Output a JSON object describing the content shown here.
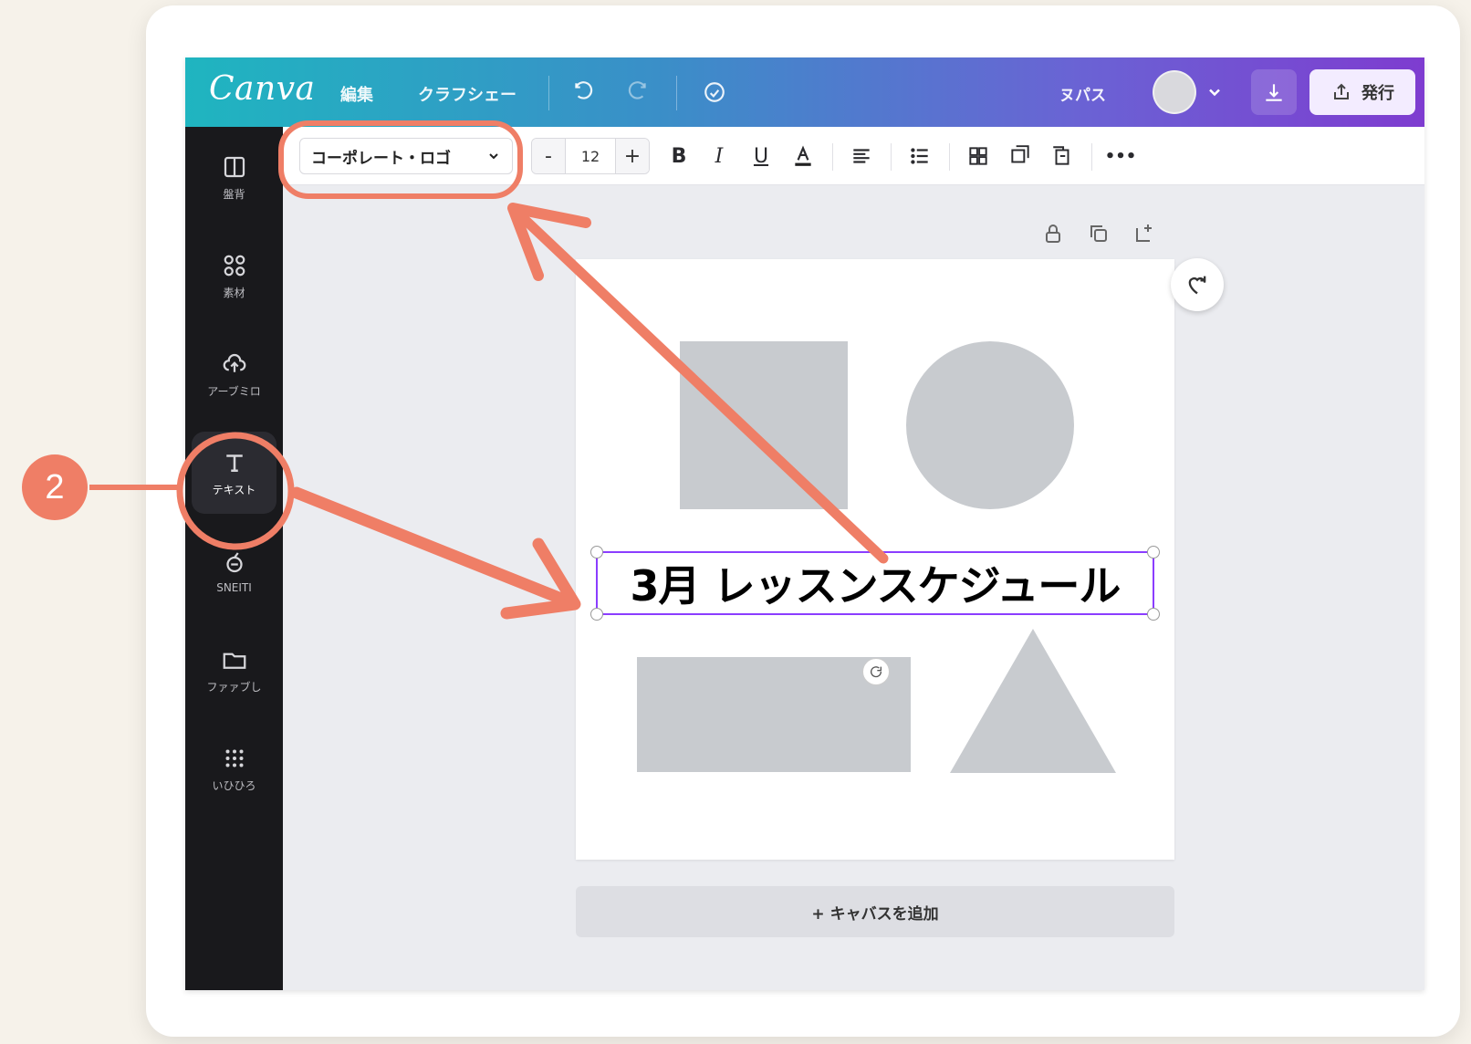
{
  "topbar": {
    "logo": "Canva",
    "nav": [
      "編集",
      "クラフシェー"
    ],
    "right_label": "ヌパス",
    "share_label": "発行"
  },
  "toolbar": {
    "font_name": "コーポレート・ロゴ",
    "font_size": "12",
    "minus_label": "-",
    "plus_label": "+",
    "bold_label": "B",
    "italic_label": "I",
    "underline_label": "U",
    "more_label": "•••"
  },
  "sidebar": {
    "items": [
      {
        "label": "盤背",
        "icon": "layout-icon"
      },
      {
        "label": "素材",
        "icon": "elements-icon"
      },
      {
        "label": "アーブミロ",
        "icon": "upload-icon"
      },
      {
        "label": "テキスト",
        "icon": "text-icon",
        "active": true
      },
      {
        "label": "SNEITI",
        "icon": "brand-icon"
      },
      {
        "label": "ファァブし",
        "icon": "folder-icon"
      },
      {
        "label": "いひひろ",
        "icon": "apps-icon"
      }
    ]
  },
  "canvas": {
    "heading": "3月 レッスンスケジュール",
    "add_page_label": "+ キャバスを追加"
  },
  "annotation": {
    "step_number": "2",
    "color": "#ef7e66"
  }
}
